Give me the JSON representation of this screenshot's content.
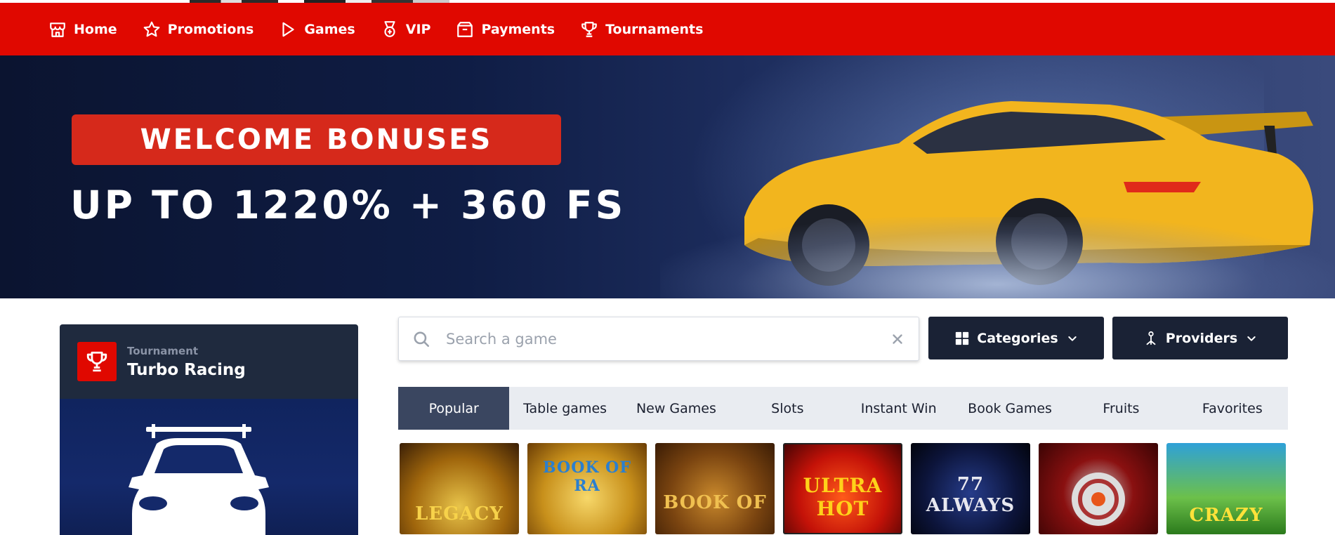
{
  "nav": {
    "items": [
      {
        "label": "Home",
        "icon": "store-icon"
      },
      {
        "label": "Promotions",
        "icon": "star-icon"
      },
      {
        "label": "Games",
        "icon": "play-icon"
      },
      {
        "label": "VIP",
        "icon": "medal-icon"
      },
      {
        "label": "Payments",
        "icon": "wallet-icon"
      },
      {
        "label": "Tournaments",
        "icon": "trophy-icon"
      }
    ],
    "colors": {
      "background": "#e00800",
      "text": "#ffffff"
    }
  },
  "hero": {
    "badge": "WELCOME BONUSES",
    "headline": "UP TO 1220% + 360 FS",
    "colors": {
      "badge": "#d6291b",
      "car": "#f2b51e"
    }
  },
  "tournament": {
    "kicker": "Tournament",
    "name": "Turbo Racing",
    "icon": "trophy-icon",
    "image_icon": "race-car-icon"
  },
  "search": {
    "placeholder": "Search a game",
    "value": ""
  },
  "filters": {
    "categories_label": "Categories",
    "providers_label": "Providers"
  },
  "tabs": [
    {
      "label": "Popular",
      "active": true
    },
    {
      "label": "Table games",
      "active": false
    },
    {
      "label": "New Games",
      "active": false
    },
    {
      "label": "Slots",
      "active": false
    },
    {
      "label": "Instant Win",
      "active": false
    },
    {
      "label": "Book Games",
      "active": false
    },
    {
      "label": "Fruits",
      "active": false
    },
    {
      "label": "Favorites",
      "active": false
    }
  ],
  "games": [
    {
      "title": "LEGACY",
      "color": "#a0660c"
    },
    {
      "title": "BOOK OF RA",
      "color": "#c8901b"
    },
    {
      "title": "BOOK OF",
      "color": "#7a4410"
    },
    {
      "title": "ULTRA HOT",
      "color": "#c41208"
    },
    {
      "title": "77 ALWAYS",
      "color": "#0c143a"
    },
    {
      "title": "",
      "color": "#8a1010"
    },
    {
      "title": "CRAZY",
      "color": "#6cc04a"
    }
  ]
}
